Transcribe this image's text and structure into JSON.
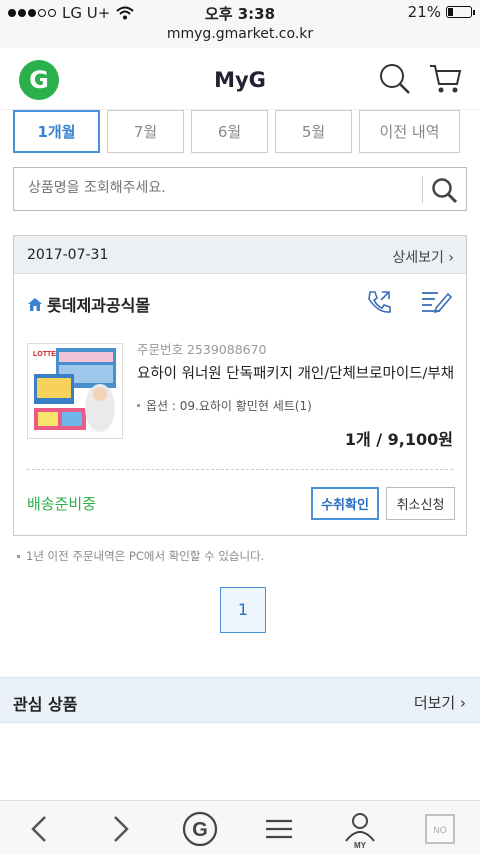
{
  "status_bar": {
    "carrier": "LG U+",
    "time": "오후 3:38",
    "battery_text": "21%",
    "battery_level": 0.21,
    "signal_bars_filled": 3,
    "signal_bars_total": 5
  },
  "url_bar": {
    "url": "mmyg.gmarket.co.kr"
  },
  "header": {
    "logo_letter": "G",
    "title": "MyG",
    "brand_color": "#2bb14b"
  },
  "month_tabs": [
    {
      "label": "1개월",
      "active": true
    },
    {
      "label": "7월",
      "active": false
    },
    {
      "label": "6월",
      "active": false
    },
    {
      "label": "5월",
      "active": false
    },
    {
      "label": "이전 내역",
      "active": false
    }
  ],
  "search": {
    "placeholder": "상품명을 조회해주세요."
  },
  "order": {
    "date": "2017-07-31",
    "detail_label": "상세보기",
    "seller": "롯데제과공식몰",
    "order_number": "주문번호 2539088670",
    "product_name": "요하이 워너원 단독패키지 개인/단체브로마이드/부채",
    "option": "옵션 : 09.요하이 황민현 세트(1)",
    "quantity_price": "1개 / 9,100원",
    "thumbnail_brand": "LOTTE",
    "status": "배송준비중",
    "confirm_label": "수취확인",
    "cancel_label": "취소신청"
  },
  "note": "1년 이전 주문내역은 PC에서 확인할 수 있습니다.",
  "pagination": {
    "current_page": "1"
  },
  "interest": {
    "title": "관심 상품",
    "more_label": "더보기"
  },
  "toolbar": {
    "my_label": "MY",
    "no_label": "NO"
  },
  "colors": {
    "accent_blue": "#4a90d9",
    "status_green": "#2db14b",
    "section_bg": "#eaf1f9"
  }
}
